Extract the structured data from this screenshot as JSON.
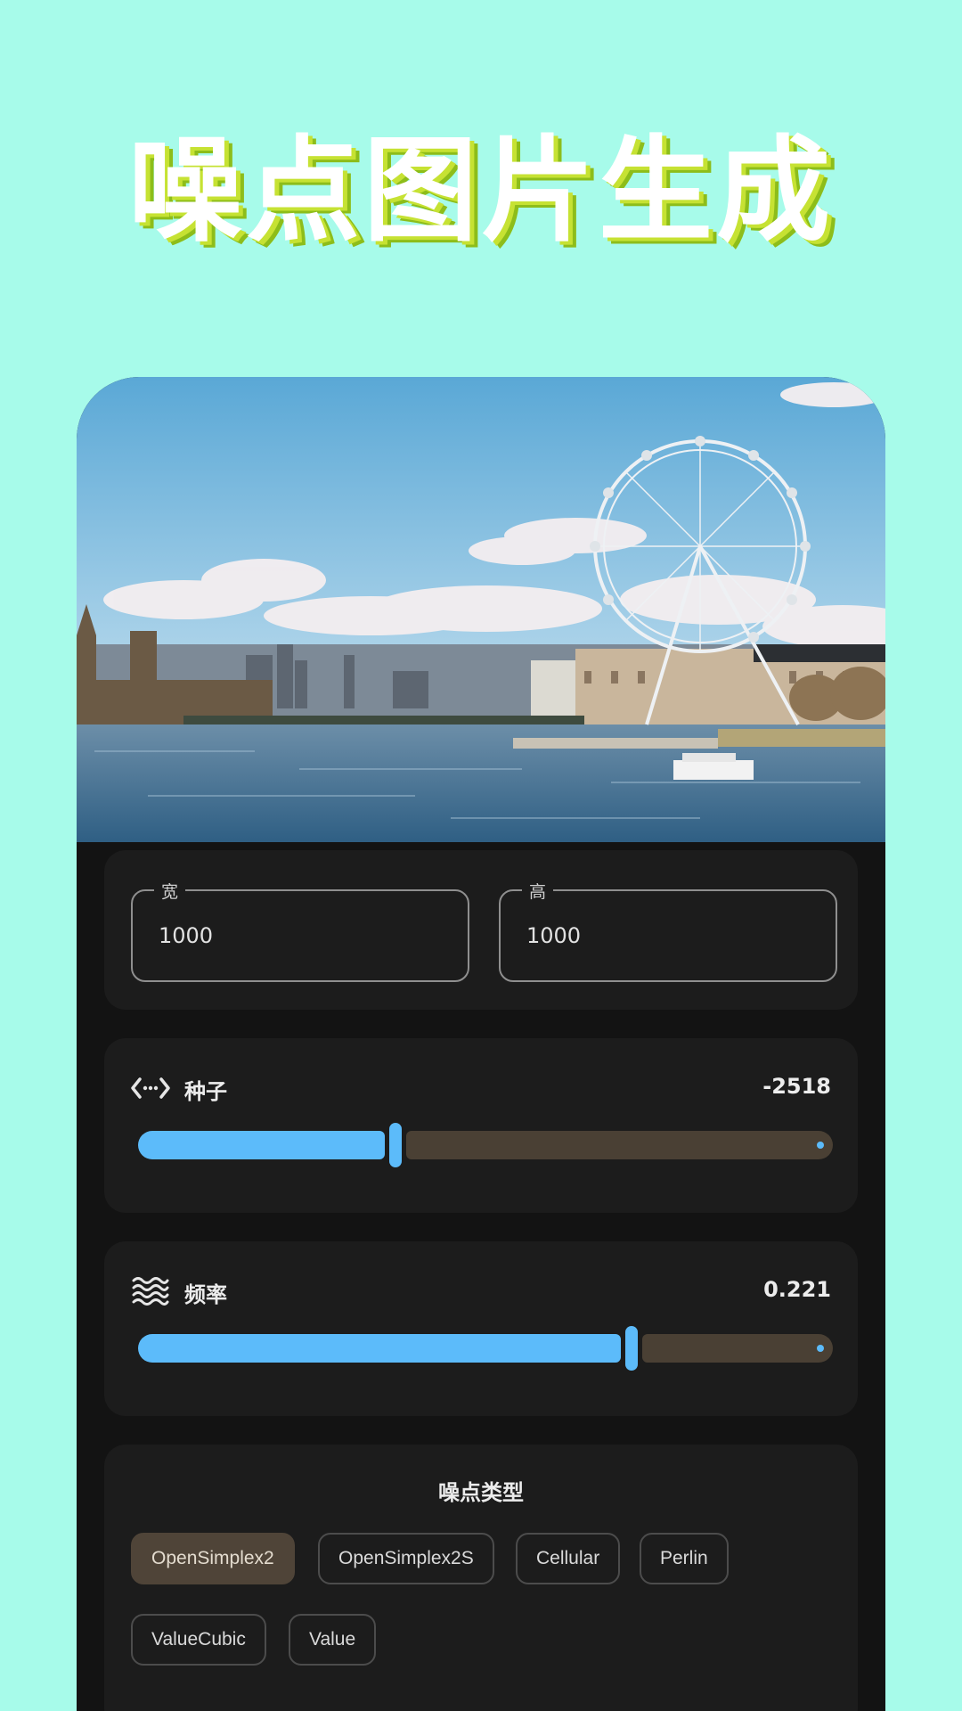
{
  "header": {
    "title": "噪点图片生成"
  },
  "preview": {
    "image": "london-eye-thames-photo"
  },
  "size": {
    "width": {
      "label": "宽",
      "value": "1000"
    },
    "height": {
      "label": "高",
      "value": "1000"
    }
  },
  "seed": {
    "icon": "code-icon",
    "label": "种子",
    "value": "-2518",
    "fraction": 0.37
  },
  "frequency": {
    "icon": "waves-icon",
    "label": "频率",
    "value": "0.221",
    "fraction": 0.71
  },
  "noise_type": {
    "title": "噪点类型",
    "selected": "OpenSimplex2",
    "options": [
      "OpenSimplex2",
      "OpenSimplex2S",
      "Cellular",
      "Perlin",
      "ValueCubic",
      "Value"
    ]
  },
  "colors": {
    "background": "#a7fbea",
    "panel": "#131313",
    "card": "#1c1c1c",
    "accent": "#5cbbfa",
    "track_inactive": "#4a4034",
    "chip_selected": "#4f4438"
  }
}
